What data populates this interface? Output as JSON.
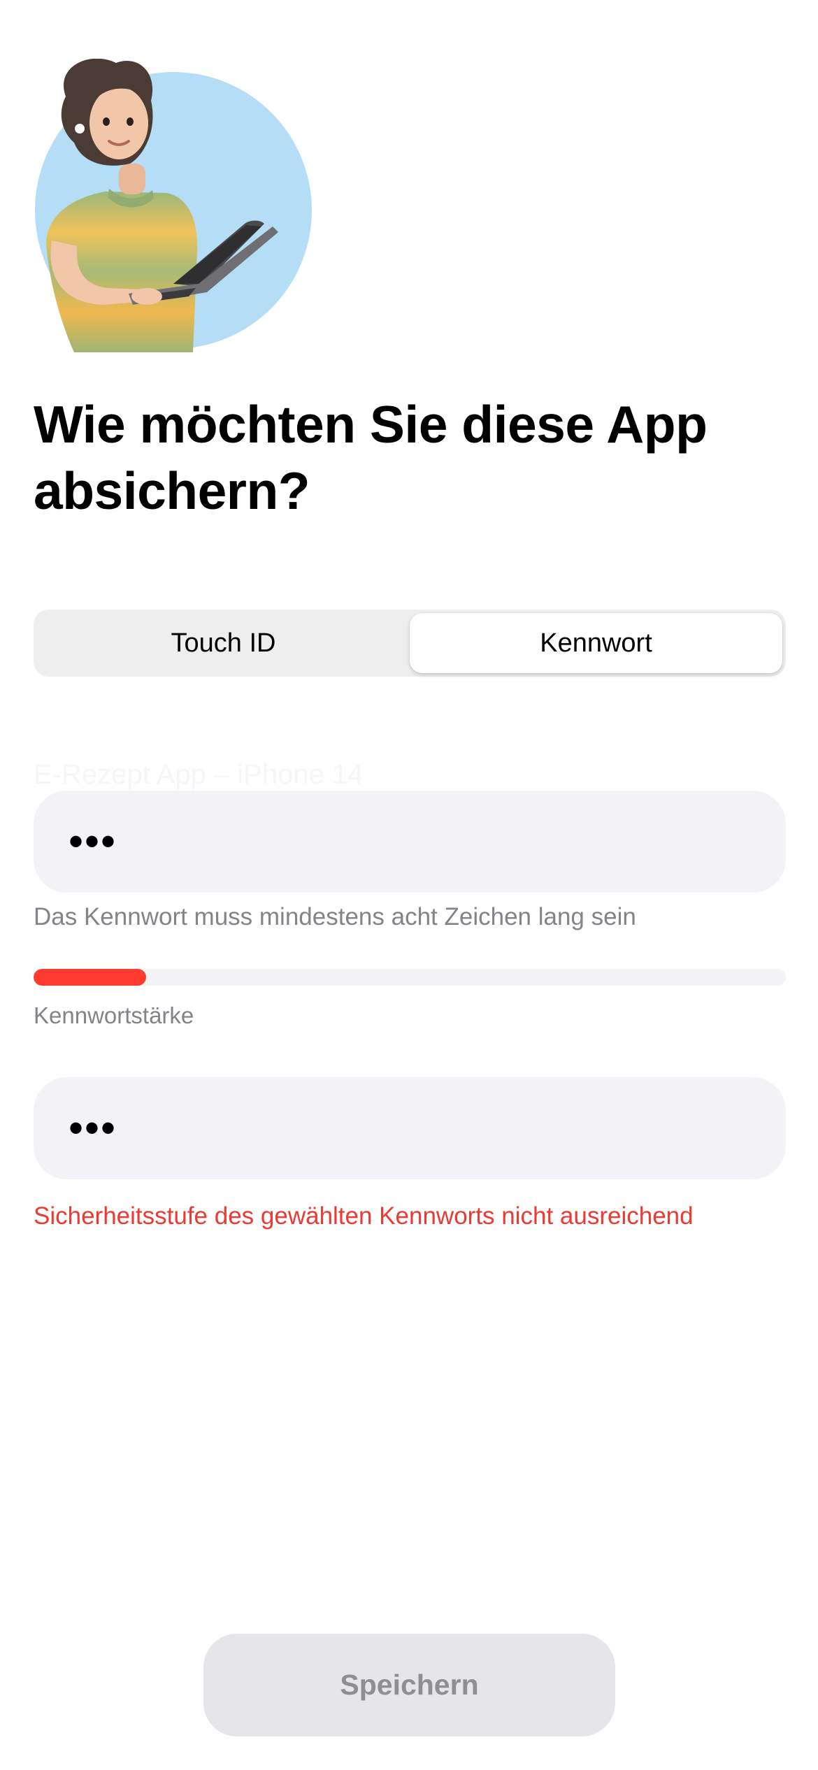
{
  "header": {
    "title": "Wie möchten Sie diese App absichern?"
  },
  "auth_method": {
    "options": [
      "Touch ID",
      "Kennwort"
    ],
    "selected": "Kennwort"
  },
  "password_form": {
    "context_label": "E-Rezept App – iPhone 14",
    "password_masked": "•••",
    "hint": "Das Kennwort muss mindestens acht Zeichen lang sein",
    "strength": {
      "label": "Kennwortstärke",
      "level": 0.15,
      "color": "#ff3b30"
    },
    "repeat_masked": "•••",
    "error": "Sicherheitsstufe des gewählten Kennworts nicht ausreichend"
  },
  "footer": {
    "save_label": "Speichern"
  },
  "colors": {
    "error": "#ec3a32",
    "field_background": "#f2f2f7",
    "disabled_button": "#e5e5ea"
  }
}
